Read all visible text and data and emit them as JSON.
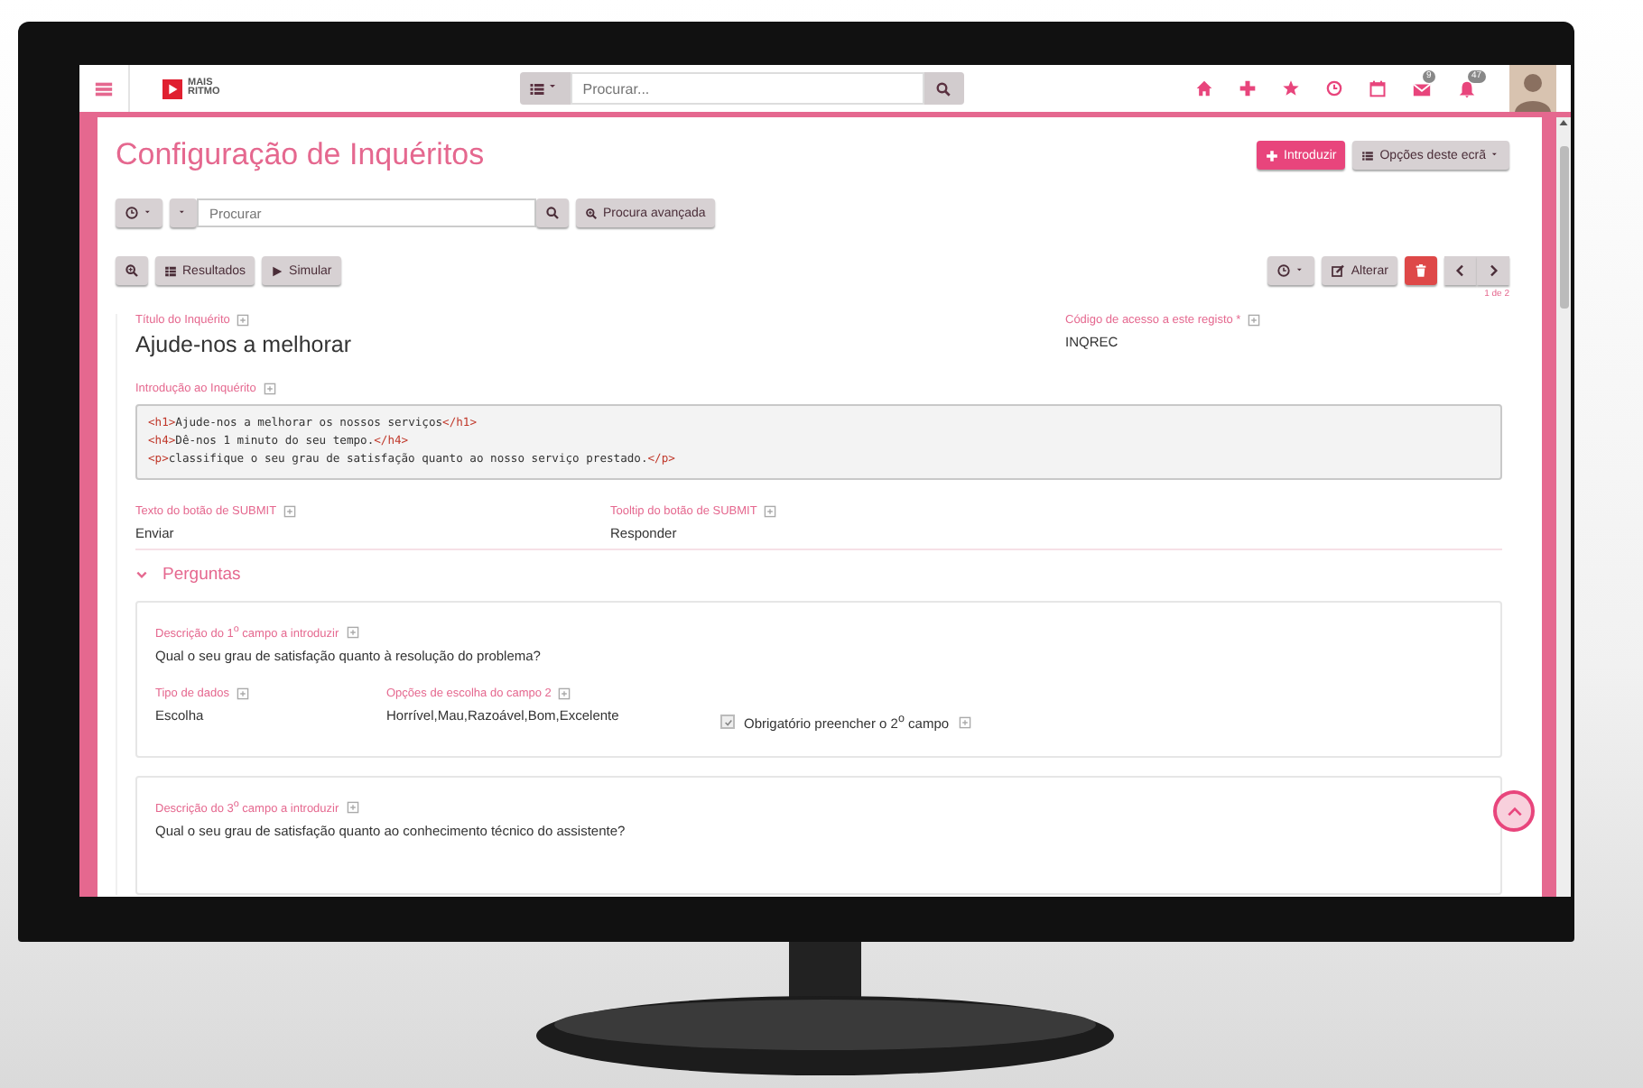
{
  "topbar": {
    "logo": {
      "line_1": "MAIS",
      "line_2": "RITMO"
    },
    "search_placeholder": "Procurar...",
    "mail_badge": "9",
    "alerts_badge": "47"
  },
  "page": {
    "title": "Configuração de Inquéritos",
    "new_button": "Introduzir",
    "options_button": "Opções deste ecrã"
  },
  "search": {
    "placeholder": "Procurar",
    "advanced_button": "Procura avançada"
  },
  "toolbar": {
    "buttons": [
      "Resultados",
      "Simular"
    ],
    "edit_button": "Alterar",
    "pager": "1 de 2"
  },
  "record": {
    "title_label": "Título do Inquérito",
    "title_value": "Ajude-nos a melhorar",
    "code_label": "Código de acesso a este registo *",
    "code_value": "INQREC",
    "intro_label": "Introdução ao Inquérito",
    "intro_lines": [
      {
        "open": "<h1>",
        "text": "Ajude-nos a melhorar os nossos serviços",
        "close": "</h1>"
      },
      {
        "open": "<h4>",
        "text": "Dê-nos 1 minuto do seu tempo.",
        "close": "</h4>"
      },
      {
        "open": "<p>",
        "text": "classifique o seu grau de satisfação quanto ao nosso serviço prestado.",
        "close": "</p>"
      }
    ],
    "submit_text_label": "Texto do botão de SUBMIT",
    "submit_text": "Enviar",
    "submit_tooltip_label": "Tooltip do botão de SUBMIT",
    "submit_tooltip": "Responder"
  },
  "questions_section": {
    "title": "Perguntas",
    "expanded": true
  },
  "questions": [
    {
      "label": "Descrição do 1$^{o}$ campo a introduzir",
      "text": "Qual o seu grau de satisfação quanto à resolução do problema?",
      "data_type_label": "Tipo de dados",
      "data_type": "Escolha",
      "options_label": "Opções de escolha do campo 2",
      "options": "Horrível,Mau,Razoável,Bom,Excelente",
      "required": {
        "label": "Obrigatório preencher o 2$^{o}$ campo",
        "checked": true
      }
    },
    {
      "label": "Descrição do 3$^{o}$ campo a introduzir",
      "text": "Qual o seu grau de satisfação quanto ao conhecimento técnico do assistente?"
    }
  ]
}
